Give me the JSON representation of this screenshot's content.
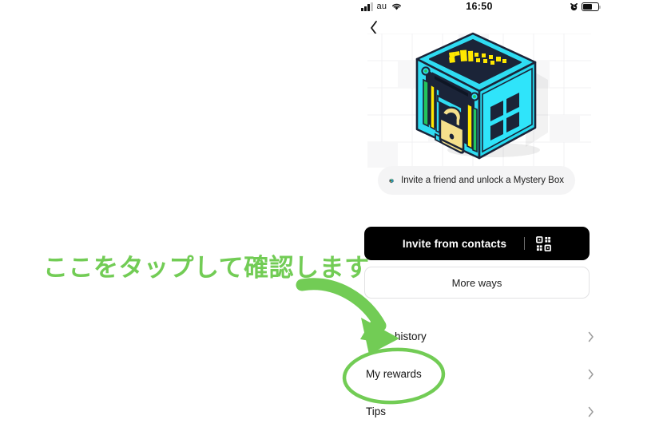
{
  "status_bar": {
    "carrier": "au",
    "time": "16:50",
    "signal_icon": "signal-bars-icon",
    "wifi_icon": "wifi-icon",
    "alarm_icon": "alarm-clock-icon",
    "battery_icon": "battery-icon"
  },
  "nav": {
    "back_icon": "chevron-left-icon"
  },
  "hero": {
    "box_icon": "mystery-box-illustration",
    "box_top_text": "OK!",
    "colors": {
      "box_cyan": "#22D3EE",
      "box_cyan_light": "#3FE3F5",
      "box_dark": "#1B2438",
      "lock_yellow": "#F5E08C",
      "accent_yellow": "#FFE800",
      "accent_green": "#22C55E"
    }
  },
  "pill": {
    "icon": "mystery-box-icon",
    "text": "Invite a friend and unlock a Mystery Box"
  },
  "invite_button": {
    "label": "Invite from contacts",
    "qr_icon": "qr-code-icon",
    "background": "#000000"
  },
  "more_button": {
    "label": "More ways"
  },
  "list": {
    "rows": [
      {
        "label": "Invite history",
        "chevron_icon": "chevron-right-icon"
      },
      {
        "label": "My rewards",
        "chevron_icon": "chevron-right-icon"
      },
      {
        "label": "Tips",
        "chevron_icon": "chevron-right-icon"
      }
    ]
  },
  "annotation": {
    "text": "ここをタップして確認します",
    "color": "#72CC55",
    "arrow_icon": "curved-arrow-icon",
    "highlight_icon": "ellipse-highlight-icon"
  }
}
